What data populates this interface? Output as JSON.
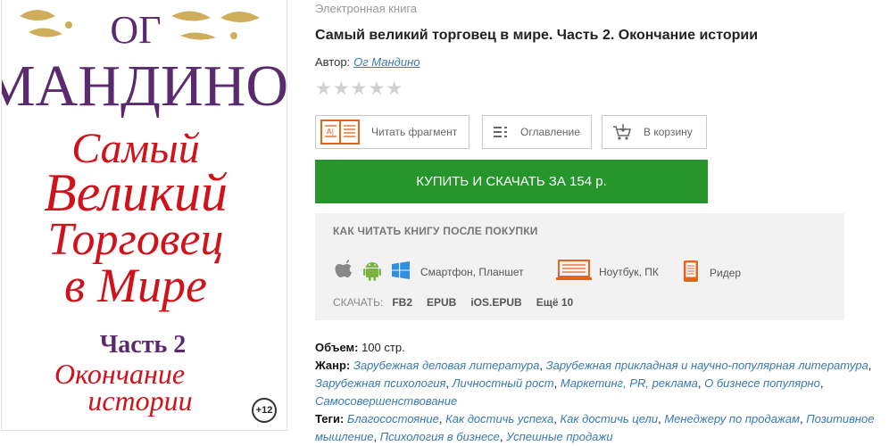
{
  "cover": {
    "author_line1": "Ог",
    "author_line2": "Мандино",
    "title_lines": [
      "Самый",
      "Великий",
      "Торговец",
      "в Мире"
    ],
    "part": "Часть 2",
    "subtitle_lines": [
      "Окончание",
      "истории"
    ],
    "age": "+12"
  },
  "book": {
    "type": "Электронная книга",
    "title": "Самый великий торговец в мире. Часть 2. Окончание истории",
    "author_label": "Автор:",
    "author_name": "Ог Мандино",
    "rating": "★★★★★"
  },
  "actions": {
    "read_fragment": "Читать фрагмент",
    "contents": "Оглавление",
    "to_cart": "В корзину",
    "buy": "КУПИТЬ И СКАЧАТЬ ЗА 154 р."
  },
  "howto": {
    "title": "КАК ЧИТАТЬ КНИГУ ПОСЛЕ ПОКУПКИ",
    "smartphone": "Смартфон, Планшет",
    "laptop": "Ноутбук, ПК",
    "reader": "Ридер",
    "download_label": "СКАЧАТЬ:",
    "formats": [
      "FB2",
      "EPUB",
      "iOS.EPUB",
      "Ещё 10"
    ]
  },
  "meta": {
    "volume_label": "Объем:",
    "volume_value": "100 стр.",
    "genre_label": "Жанр:",
    "genres": [
      "Зарубежная деловая литература",
      "Зарубежная прикладная и научно-популярная литература",
      "Зарубежная психология",
      "Личностный рост",
      "Маркетинг, PR, реклама",
      "О бизнесе популярно",
      "Самосовершенствование"
    ],
    "tags_label": "Теги:",
    "tags": [
      "Благосостояние",
      "Как достичь успеха",
      "Как достичь цели",
      "Менеджеру по продажам",
      "Позитивное мышление",
      "Психология в бизнесе",
      "Успешные продажи"
    ]
  },
  "colors": {
    "buy_green": "#26952c",
    "link_blue": "#3a79b1",
    "cover_purple": "#5a2a6e",
    "cover_red": "#d0121b",
    "ornament_gold": "#c9a64a",
    "icon_orange": "#e8641c"
  }
}
